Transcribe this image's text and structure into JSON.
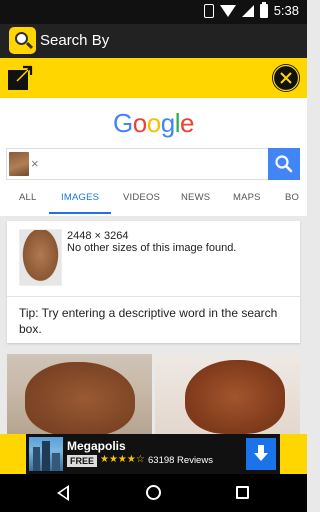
{
  "status_bar": {
    "time": "5:38"
  },
  "app_bar": {
    "title": "Search By"
  },
  "toolbar": {
    "expand_icon": "expand-icon",
    "close_icon": "close-icon"
  },
  "google": {
    "logo_letters": [
      {
        "ch": "G",
        "color": "#4285F4"
      },
      {
        "ch": "o",
        "color": "#EA4335"
      },
      {
        "ch": "o",
        "color": "#FBBC05"
      },
      {
        "ch": "g",
        "color": "#4285F4"
      },
      {
        "ch": "l",
        "color": "#34A853"
      },
      {
        "ch": "e",
        "color": "#EA4335"
      }
    ],
    "search": {
      "chip_remove": "×",
      "value": ""
    },
    "tabs": [
      "ALL",
      "IMAGES",
      "VIDEOS",
      "NEWS",
      "MAPS",
      "BO"
    ],
    "active_tab": "IMAGES"
  },
  "result_card": {
    "dimensions": "2448 × 3264",
    "no_sizes": "No other sizes of this image found.",
    "tip": "Tip: Try entering a descriptive word in the search box."
  },
  "ad": {
    "app_name": "Megapolis",
    "badge": "FREE",
    "stars": "★★★★☆",
    "reviews": "63198 Reviews"
  },
  "colors": {
    "brand_yellow": "#FFD600",
    "google_blue": "#4285F4"
  }
}
